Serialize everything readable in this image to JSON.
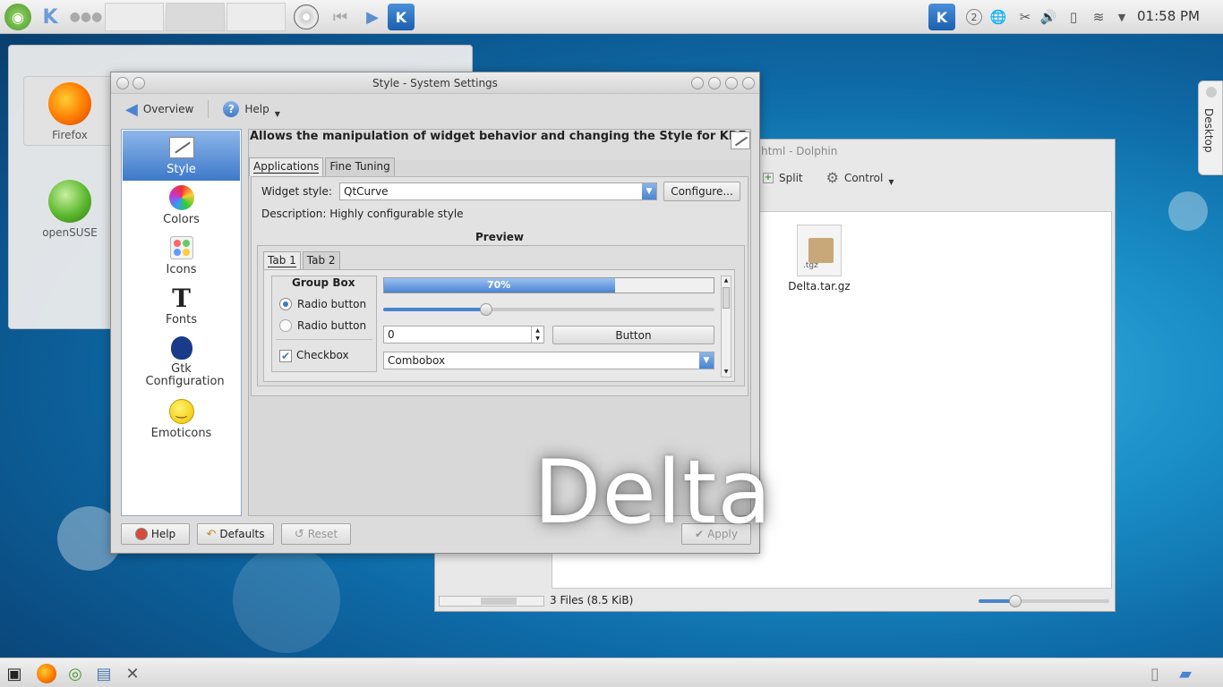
{
  "top_panel": {
    "clock": "01:58 PM",
    "pager_number": "2"
  },
  "desktop": {
    "icons": [
      {
        "label": "Firefox"
      },
      {
        "label": "openSUSE"
      }
    ],
    "toolbox_label": "Desktop",
    "overlay_text": "Delta"
  },
  "dolphin": {
    "title": "html - Dolphin",
    "toolbar": {
      "split": "Split",
      "control": "Control"
    },
    "file": {
      "name": "Delta.tar.gz",
      "ext": ".tgz"
    },
    "status": "3 Files (8.5 KiB)"
  },
  "style_window": {
    "title": "Style - System Settings",
    "toolbar": {
      "overview": "Overview",
      "help": "Help"
    },
    "categories": [
      {
        "label": "Style"
      },
      {
        "label": "Colors"
      },
      {
        "label": "Icons"
      },
      {
        "label": "Fonts"
      },
      {
        "label": "Gtk Configuration"
      },
      {
        "label": "Emoticons"
      }
    ],
    "description_header": "Allows the manipulation of widget behavior and changing the Style for KDE",
    "tabs": {
      "applications": "Applications",
      "fine_tuning": "Fine Tuning"
    },
    "widget_style_label": "Widget style:",
    "widget_style_value": "QtCurve",
    "configure_button": "Configure...",
    "description": "Description: Highly configurable style",
    "preview": {
      "title": "Preview",
      "tab1": "Tab 1",
      "tab2": "Tab 2",
      "group_box": "Group Box",
      "radio1": "Radio button",
      "radio2": "Radio button",
      "checkbox": "Checkbox",
      "progress_text": "70%",
      "progress_value": 0.7,
      "slider_value": 0.31,
      "spin_value": "0",
      "button": "Button",
      "combobox": "Combobox"
    },
    "buttons": {
      "help": "Help",
      "defaults": "Defaults",
      "reset": "Reset",
      "apply": "Apply"
    }
  }
}
